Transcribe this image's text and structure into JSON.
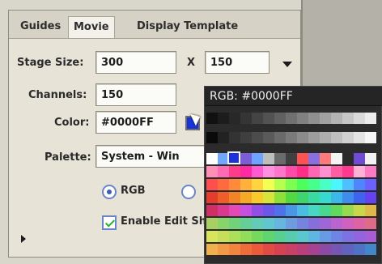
{
  "tabs": [
    {
      "label": "Guides"
    },
    {
      "label": "Movie"
    },
    {
      "label": "Display Template"
    }
  ],
  "stage": {
    "label": "Stage Size:",
    "width": "300",
    "x": "X",
    "height": "150"
  },
  "channels": {
    "label": "Channels:",
    "value": "150"
  },
  "color": {
    "label": "Color:",
    "value": "#0000FF",
    "swatch": "#1833d9"
  },
  "palette": {
    "label": "Palette:",
    "value": "System - Win"
  },
  "options": {
    "rgb_label": "RGB",
    "enable_label": "Enable Edit Sh"
  },
  "picker": {
    "title": "RGB: #0000FF"
  },
  "icons": {
    "dropdown": "chevron-down-icon",
    "expand": "chevron-right-icon",
    "cursor": "mouse-pointer-icon"
  }
}
